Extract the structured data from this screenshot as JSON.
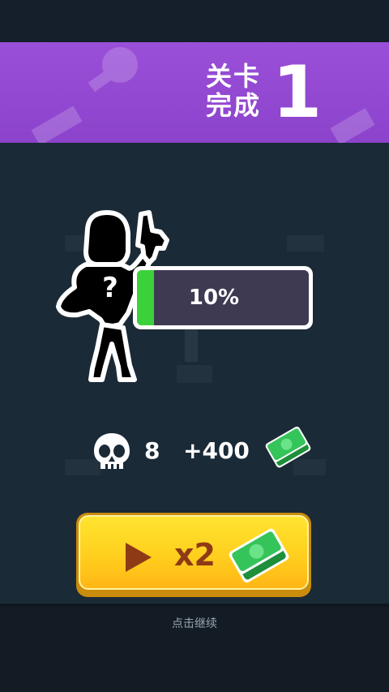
{
  "banner": {
    "level_label_line1": "关卡",
    "level_label_line2": "完成",
    "level_number": "1",
    "color": "#9a4fd8"
  },
  "unlock": {
    "progress_text": "10%",
    "progress_value": 0.1,
    "fill_color": "#3bd13b",
    "silhouette_mark": "?"
  },
  "stats": {
    "kills": "8",
    "reward": "+400",
    "kill_icon": "skull-icon",
    "reward_icon": "cash-icon"
  },
  "button": {
    "label": "x2",
    "icon": "play-icon",
    "reward_icon": "cash-icon"
  },
  "footer": {
    "continue_text": "点击继续"
  }
}
